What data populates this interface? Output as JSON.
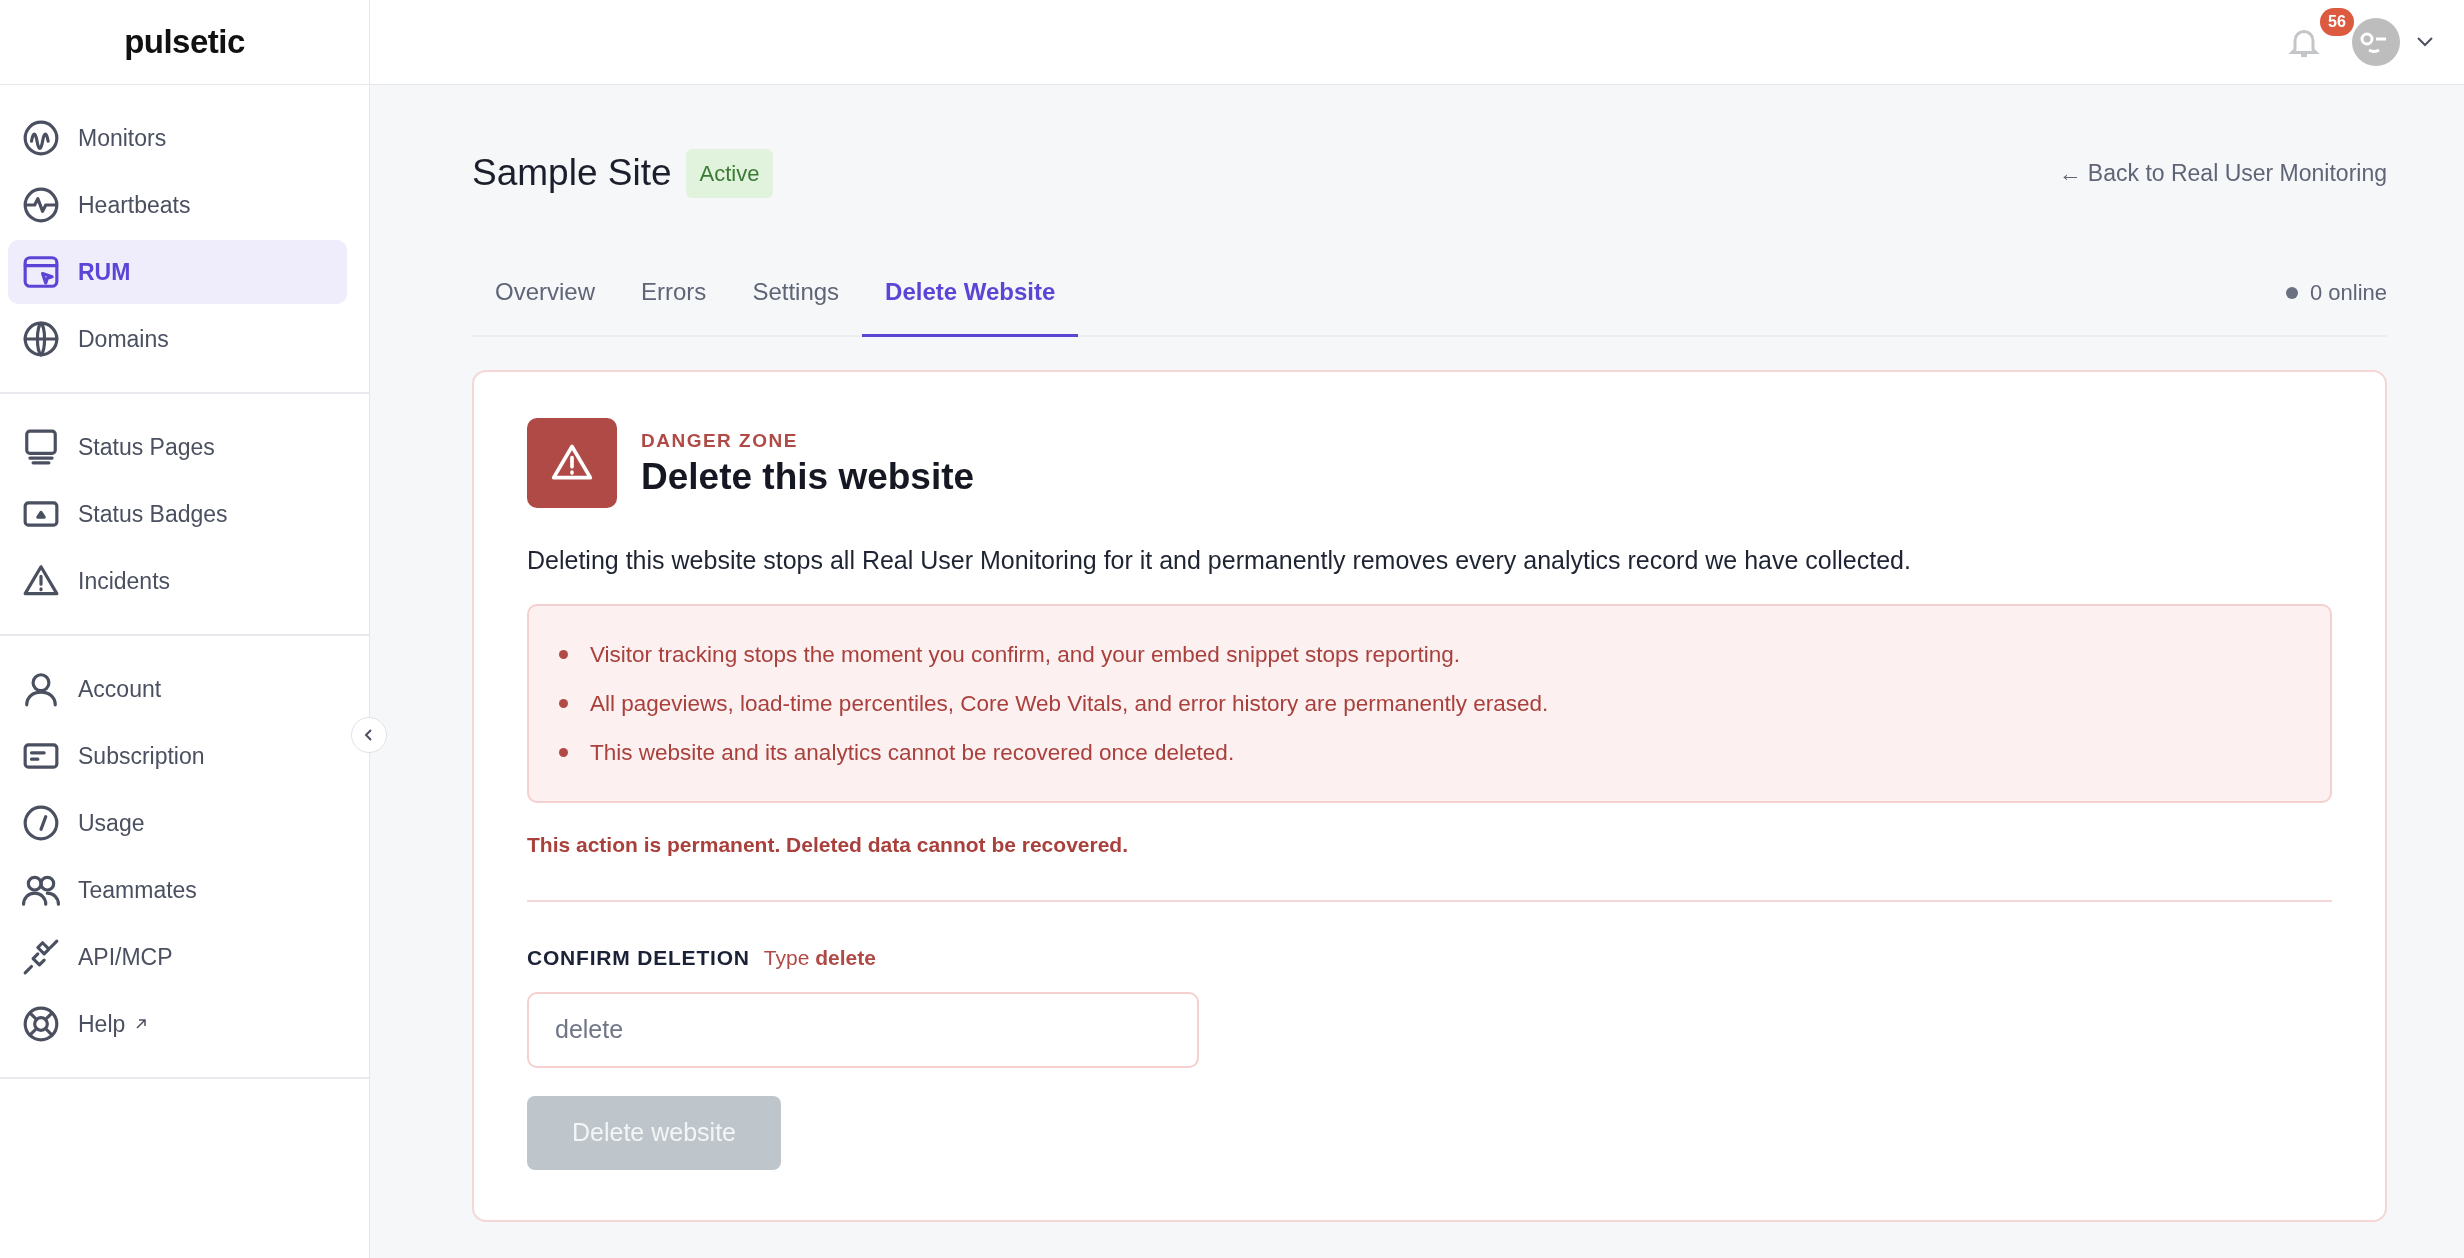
{
  "brand": "pulsetic",
  "sidebar": {
    "groups": [
      [
        {
          "label": "Monitors",
          "selected": false
        },
        {
          "label": "Heartbeats",
          "selected": false
        },
        {
          "label": "RUM",
          "selected": true
        },
        {
          "label": "Domains",
          "selected": false
        }
      ],
      [
        {
          "label": "Status Pages",
          "selected": false
        },
        {
          "label": "Status Badges",
          "selected": false
        },
        {
          "label": "Incidents",
          "selected": false
        }
      ],
      [
        {
          "label": "Account",
          "selected": false
        },
        {
          "label": "Subscription",
          "selected": false
        },
        {
          "label": "Usage",
          "selected": false
        },
        {
          "label": "Teammates",
          "selected": false
        },
        {
          "label": "API/MCP",
          "selected": false
        },
        {
          "label": "Help",
          "selected": false,
          "external": true
        }
      ]
    ]
  },
  "topbar": {
    "notification_count": "56"
  },
  "page": {
    "title": "Sample Site",
    "status": "Active",
    "back_link": "← Back to Real User Monitoring",
    "tabs": [
      {
        "label": "Overview",
        "selected": false
      },
      {
        "label": "Errors",
        "selected": false
      },
      {
        "label": "Settings",
        "selected": false
      },
      {
        "label": "Delete Website",
        "selected": true
      }
    ],
    "online": "0 online"
  },
  "danger": {
    "eyebrow": "DANGER ZONE",
    "title": "Delete this website",
    "description": "Deleting this website stops all Real User Monitoring for it and permanently removes every analytics record we have collected.",
    "bullets": [
      "Visitor tracking stops the moment you confirm, and your embed snippet stops reporting.",
      "All pageviews, load-time percentiles, Core Web Vitals, and error history are permanently erased.",
      "This website and its analytics cannot be recovered once deleted."
    ],
    "warning": "This action is permanent. Deleted data cannot be recovered.",
    "confirm_label": "CONFIRM DELETION",
    "confirm_hint": "Type **delete**",
    "input": {
      "placeholder": "delete"
    },
    "button": {
      "label": "Delete website",
      "disabled": true
    }
  }
}
